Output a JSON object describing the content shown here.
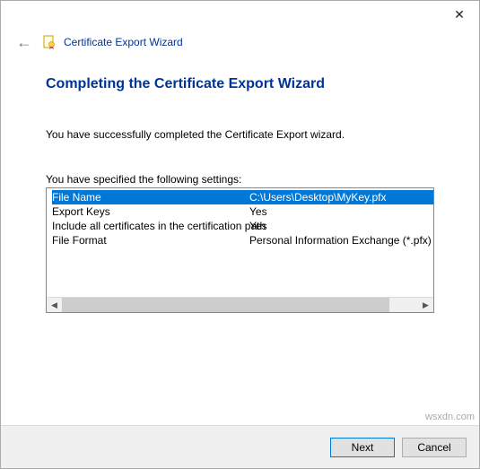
{
  "titlebar": {
    "close_glyph": "✕"
  },
  "header": {
    "back_glyph": "←",
    "wizard_title": "Certificate Export Wizard"
  },
  "page": {
    "heading": "Completing the Certificate Export Wizard",
    "intro": "You have successfully completed the Certificate Export wizard.",
    "settings_label": "You have specified the following settings:",
    "rows": [
      {
        "label": "File Name",
        "value": "C:\\Users\\Desktop\\MyKey.pfx",
        "selected": true
      },
      {
        "label": "Export Keys",
        "value": "Yes",
        "selected": false
      },
      {
        "label": "Include all certificates in the certification path",
        "value": "Yes",
        "selected": false
      },
      {
        "label": "File Format",
        "value": "Personal Information Exchange (*.pfx)",
        "selected": false
      }
    ],
    "scroll": {
      "left_glyph": "◀",
      "right_glyph": "▶"
    }
  },
  "footer": {
    "next_label": "Next",
    "cancel_label": "Cancel"
  },
  "watermark": "wsxdn.com"
}
